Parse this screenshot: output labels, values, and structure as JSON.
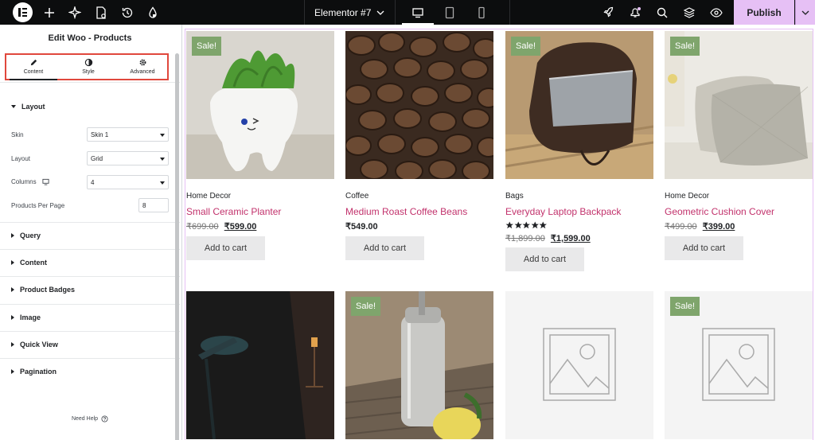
{
  "topbar": {
    "document_name": "Elementor #7",
    "publish_label": "Publish",
    "icons": [
      "elementor-logo-icon",
      "add-icon",
      "ai-icon",
      "page-settings-icon",
      "history-icon",
      "theme-style-icon",
      "launch-icon",
      "notifications-icon",
      "search-icon",
      "structure-icon",
      "preview-icon"
    ],
    "devices": [
      "desktop-icon",
      "tablet-icon",
      "mobile-icon"
    ],
    "accent": "#e6c0f5"
  },
  "panel": {
    "title": "Edit Woo - Products",
    "tabs": [
      {
        "label": "Content",
        "icon": "pencil-icon"
      },
      {
        "label": "Style",
        "icon": "contrast-icon"
      },
      {
        "label": "Advanced",
        "icon": "gear-icon"
      }
    ],
    "layout_section": {
      "title": "Layout",
      "controls": {
        "skin": {
          "label": "Skin",
          "value": "Skin 1"
        },
        "layout": {
          "label": "Layout",
          "value": "Grid"
        },
        "columns": {
          "label": "Columns",
          "value": "4"
        },
        "per_page": {
          "label": "Products Per Page",
          "value": "8"
        }
      }
    },
    "sections": [
      "Query",
      "Content",
      "Product Badges",
      "Image",
      "Quick View",
      "Pagination"
    ],
    "help_label": "Need Help",
    "highlight_color": "#e0483d"
  },
  "products": [
    {
      "category": "Home Decor",
      "name": "Small Ceramic Planter",
      "old_price": "₹699.00",
      "price": "₹599.00",
      "sale_badge": "Sale!",
      "cart_label": "Add to cart",
      "image": "ceramic-planter"
    },
    {
      "category": "Coffee",
      "name": "Medium Roast Coffee Beans",
      "price": "₹549.00",
      "cart_label": "Add to cart",
      "image": "coffee-beans"
    },
    {
      "category": "Bags",
      "name": "Everyday Laptop Backpack",
      "rating": 5,
      "old_price": "₹1,899.00",
      "price": "₹1,599.00",
      "sale_badge": "Sale!",
      "cart_label": "Add to cart",
      "image": "laptop-backpack"
    },
    {
      "category": "Home Decor",
      "name": "Geometric Cushion Cover",
      "old_price": "₹499.00",
      "price": "₹399.00",
      "sale_badge": "Sale!",
      "cart_label": "Add to cart",
      "image": "cushion"
    },
    {
      "image": "desk-lamp"
    },
    {
      "sale_badge": "Sale!",
      "image": "steel-bottle"
    },
    {
      "image": "placeholder"
    },
    {
      "sale_badge": "Sale!",
      "image": "placeholder"
    }
  ],
  "colors": {
    "product_link": "#c2326c",
    "sale_badge": "#7fa56c",
    "cart_button": "#e9e9ea"
  }
}
